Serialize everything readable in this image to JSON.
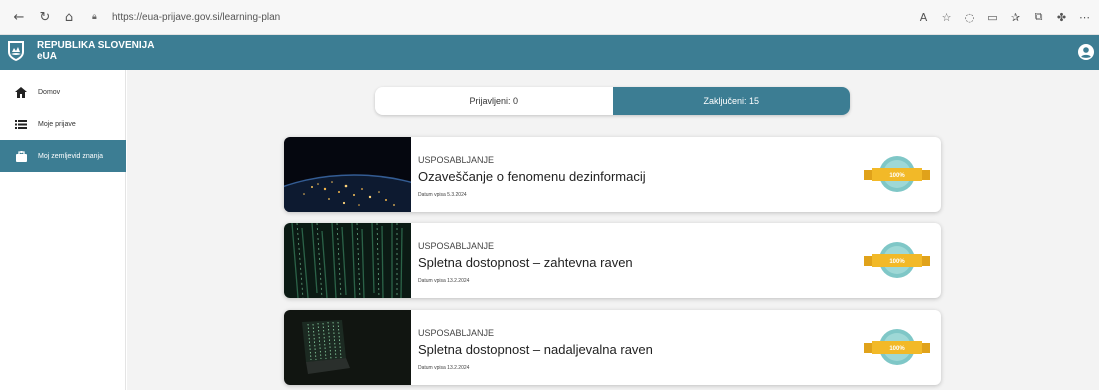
{
  "browser": {
    "url": "https://euа-prijave.gov.si/learning-plan",
    "icons": [
      "back-icon",
      "refresh-icon",
      "home-icon",
      "lock-icon",
      "read-aloud-icon",
      "favorite-icon",
      "extensions-icon",
      "split-screen-icon",
      "favorites-icon",
      "collections-icon",
      "copilot-icon",
      "more-icon"
    ]
  },
  "header": {
    "brand_line1": "REPUBLIKA SLOVENIJA",
    "brand_line2": "eUA",
    "color": "#3c7d93"
  },
  "sidebar": {
    "items": [
      {
        "label": "Domov",
        "icon": "home-icon",
        "active": false
      },
      {
        "label": "Moje prijave",
        "icon": "list-icon",
        "active": false
      },
      {
        "label": "Moj zemljevid znanja",
        "icon": "knowledge-map-icon",
        "active": true
      }
    ]
  },
  "tabs": {
    "registered": "Prijavljeni: 0",
    "completed": "Zaključeni: 15"
  },
  "cards": [
    {
      "kicker": "USPOSABLJANJE",
      "title": "Ozaveščanje o fenomenu dezinformacij",
      "date": "Datum vpisa 5.3.2024",
      "badge": "100%",
      "thumb": "earth-night"
    },
    {
      "kicker": "USPOSABLJANJE",
      "title": "Spletna dostopnost – zahtevna raven",
      "date": "Datum vpisa 13.2.2024",
      "badge": "100%",
      "thumb": "matrix-code"
    },
    {
      "kicker": "USPOSABLJANJE",
      "title": "Spletna dostopnost – nadaljevalna raven",
      "date": "Datum vpisa 13.2.2024",
      "badge": "100%",
      "thumb": "laptop-code"
    }
  ]
}
